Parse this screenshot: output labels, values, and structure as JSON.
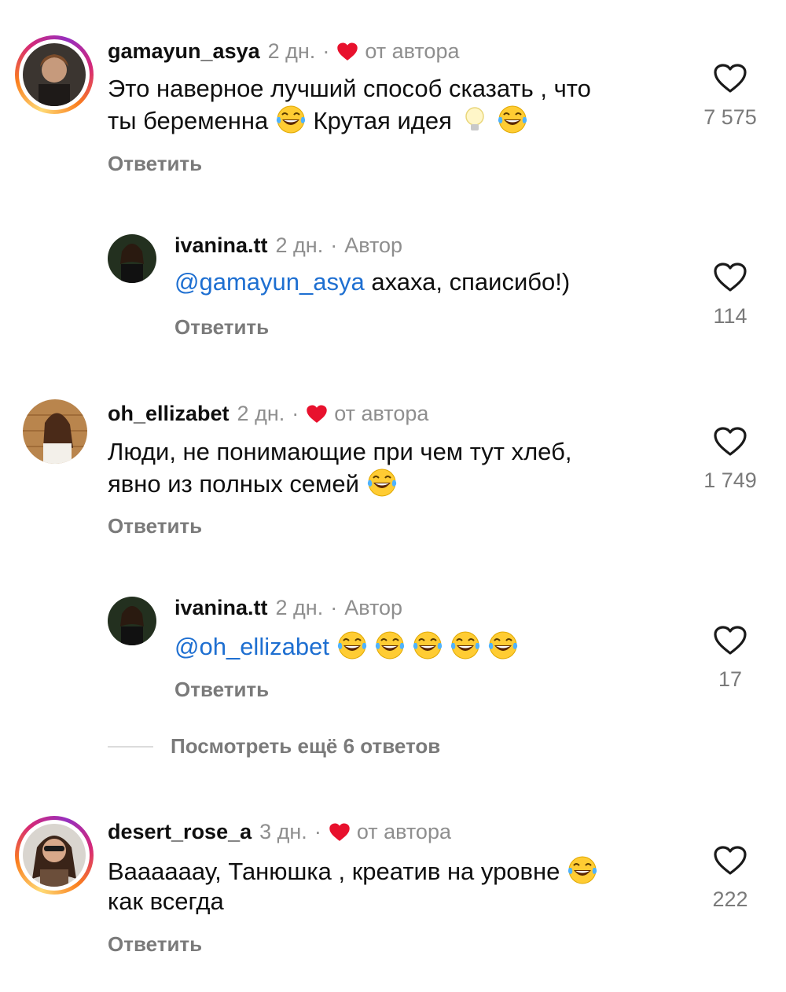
{
  "comments": [
    {
      "username": "gamayun_asya",
      "time": "2 дн.",
      "badge": "от автора",
      "text_parts": [
        "Это наверное лучший способ сказать , что",
        "ты беременна",
        "Крутая идея"
      ],
      "reply_label": "Ответить",
      "likes": "7 575"
    },
    {
      "username": "ivanina.tt",
      "time": "2 дн.",
      "badge": "Автор",
      "mention": "@gamayun_asya",
      "text": "ахаха, спаисибо!)",
      "reply_label": "Ответить",
      "likes": "114"
    },
    {
      "username": "oh_ellizabet",
      "time": "2 дн.",
      "badge": "от автора",
      "text_parts": [
        "Люди, не понимающие при чем тут хлеб,",
        "явно из полных семей"
      ],
      "reply_label": "Ответить",
      "likes": "1 749"
    },
    {
      "username": "ivanina.tt",
      "time": "2 дн.",
      "badge": "Автор",
      "mention": "@oh_ellizabet",
      "reply_label": "Ответить",
      "likes": "17"
    },
    {
      "username": "desert_rose_a",
      "time": "3 дн.",
      "badge": "от автора",
      "text_parts": [
        "Ваааааау, Танюшка , креатив на уровне",
        "как всегда"
      ],
      "reply_label": "Ответить",
      "likes": "222"
    }
  ],
  "view_more": "Посмотреть ещё 6 ответов",
  "colors": {
    "heart": "#e8112d",
    "mention": "#1e6fd1",
    "muted": "#8e8e8e"
  },
  "icons": [
    "heart-outline-icon",
    "heart-filled-icon",
    "laughing-emoji-icon",
    "lightbulb-emoji-icon"
  ]
}
